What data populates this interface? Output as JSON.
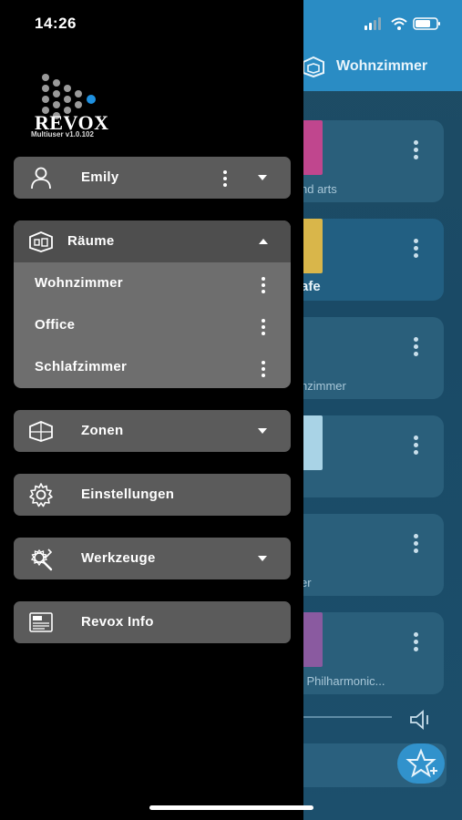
{
  "status_bar": {
    "time": "14:26"
  },
  "background": {
    "header_title": "Wohnzimmer",
    "cards": [
      {
        "subtitle": "nd arts",
        "thumb_color": "#c0468e"
      },
      {
        "subtitle": "afe",
        "thumb_color": "#d9b64a"
      },
      {
        "subtitle": "nzimmer",
        "thumb_color": ""
      },
      {
        "subtitle": "",
        "thumb_color": "#a9d3e6"
      },
      {
        "subtitle": "er",
        "thumb_color": ""
      },
      {
        "subtitle": "l Philharmonic...",
        "thumb_color": "#8a5aa0"
      }
    ]
  },
  "drawer": {
    "brand": {
      "wordmark": "REVOX",
      "version": "Multiuser v1.0.102"
    },
    "user": {
      "label": "Emily",
      "icon": "user-icon"
    },
    "rooms": {
      "label": "Räume",
      "icon": "room-icon",
      "items": [
        {
          "label": "Wohnzimmer"
        },
        {
          "label": "Office"
        },
        {
          "label": "Schlafzimmer"
        }
      ]
    },
    "zones": {
      "label": "Zonen",
      "icon": "zone-icon"
    },
    "settings": {
      "label": "Einstellungen",
      "icon": "gear-icon"
    },
    "tools": {
      "label": "Werkzeuge",
      "icon": "tools-icon"
    },
    "info": {
      "label": "Revox Info",
      "icon": "info-icon"
    }
  },
  "colors": {
    "drawer_bg": "#000000",
    "button_bg": "#5b5b5b",
    "submenu_bg": "#6e6e6e",
    "header_blue": "#2a8cc4",
    "accent_dot": "#1e90e0"
  }
}
